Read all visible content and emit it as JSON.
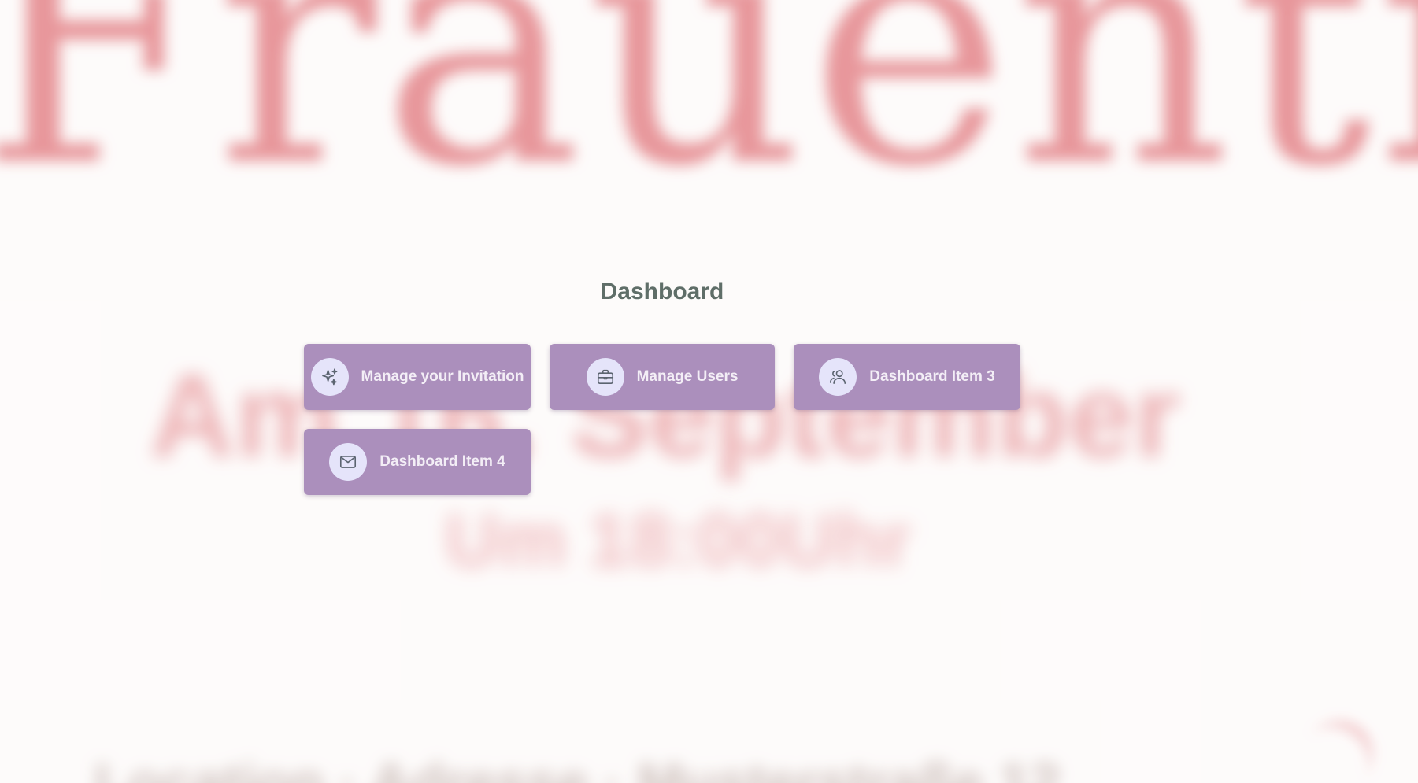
{
  "dashboard": {
    "title": "Dashboard",
    "items": [
      {
        "label": "Manage your Invitation",
        "icon": "sparkles-icon"
      },
      {
        "label": "Manage Users",
        "icon": "briefcase-icon"
      },
      {
        "label": "Dashboard Item 3",
        "icon": "users-icon"
      },
      {
        "label": "Dashboard Item 4",
        "icon": "envelope-icon"
      }
    ]
  },
  "colors": {
    "card_background": "#ab8fbc",
    "icon_circle": "#e5e4fa",
    "title_text": "#5f6e68",
    "background_accent": "#d64850"
  }
}
